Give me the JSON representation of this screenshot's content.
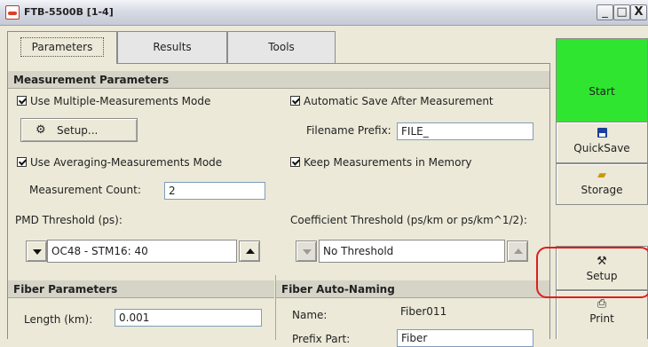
{
  "window": {
    "title": "FTB-5500B [1-4]",
    "minimize": "_",
    "maximize": "□",
    "close": "X"
  },
  "tabs": [
    {
      "label": "Parameters",
      "active": true
    },
    {
      "label": "Results",
      "active": false
    },
    {
      "label": "Tools",
      "active": false
    }
  ],
  "measurement": {
    "heading": "Measurement Parameters",
    "multi_mode_label": "Use Multiple-Measurements Mode",
    "multi_mode_checked": true,
    "setup_button": "Setup...",
    "auto_save_label": "Automatic Save After Measurement",
    "auto_save_checked": true,
    "filename_prefix_label": "Filename Prefix:",
    "filename_prefix_value": "FILE_",
    "averaging_label": "Use Averaging-Measurements Mode",
    "averaging_checked": true,
    "keep_memory_label": "Keep Measurements in Memory",
    "keep_memory_checked": true,
    "count_label": "Measurement Count:",
    "count_value": "2",
    "pmd_label": "PMD Threshold (ps):",
    "pmd_value": "OC48 - STM16: 40",
    "coeff_label": "Coefficient Threshold (ps/km or ps/km^1/2):",
    "coeff_value": "No Threshold"
  },
  "fiber": {
    "heading": "Fiber Parameters",
    "length_label": "Length (km):",
    "length_value": "0.001"
  },
  "auto_naming": {
    "heading": "Fiber Auto-Naming",
    "name_label": "Name:",
    "name_value": "Fiber011",
    "prefix_label": "Prefix Part:",
    "prefix_value": "Fiber"
  },
  "sidebar": {
    "start": "Start",
    "quicksave": "QuickSave",
    "storage": "Storage",
    "setup": "Setup",
    "print": "Print"
  },
  "colors": {
    "start_green": "#2fe52f",
    "highlight_red": "#e01e1e"
  },
  "icons": {
    "quicksave": "floppy-disk-icon",
    "storage": "folder-icon",
    "setup": "tools-icon",
    "print": "printer-icon",
    "setup_button": "settings-icon"
  }
}
